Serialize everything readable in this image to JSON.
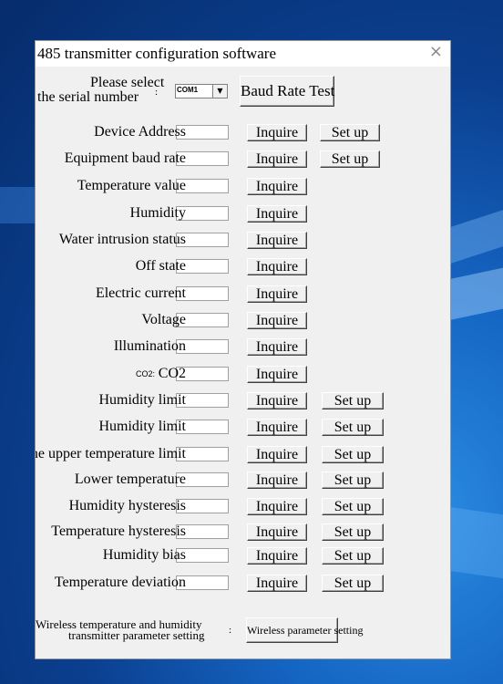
{
  "window": {
    "title": "485 transmitter configuration software",
    "close_glyph": "×"
  },
  "serial": {
    "label_line1": "Please select",
    "label_line2": "the serial number",
    "colon": ":",
    "selected_port": "COM1",
    "dropdown_glyph": "▼",
    "baud_test_label": "Baud Rate Test"
  },
  "rows": [
    {
      "label": "Device Address",
      "inquire": "Inquire",
      "setup": "Set up"
    },
    {
      "label": "Equipment baud rate",
      "inquire": "Inquire",
      "setup": "Set up"
    },
    {
      "label": "Temperature value",
      "inquire": "Inquire"
    },
    {
      "label": "Humidity",
      "inquire": "Inquire"
    },
    {
      "label": "Water intrusion status",
      "inquire": "Inquire"
    },
    {
      "label": "Off state",
      "inquire": "Inquire"
    },
    {
      "label": "Electric current",
      "inquire": "Inquire"
    },
    {
      "label": "Voltage",
      "inquire": "Inquire"
    },
    {
      "label": "Illumination",
      "inquire": "Inquire"
    },
    {
      "label": "CO2",
      "small_label": "CO2:",
      "inquire": "Inquire"
    },
    {
      "label": "Humidity limit",
      "inquire": "Inquire",
      "setup": "Set up"
    },
    {
      "label": "Humidity limit",
      "inquire": "Inquire",
      "setup": "Set up"
    },
    {
      "label": "The upper temperature limit",
      "inquire": "Inquire",
      "setup": "Set up"
    },
    {
      "label": "Lower temperature",
      "inquire": "Inquire",
      "setup": "Set up"
    },
    {
      "label": "Humidity hysteresis",
      "inquire": "Inquire",
      "setup": "Set up"
    },
    {
      "label": "Temperature hysteresis",
      "inquire": "Inquire",
      "setup": "Set up"
    },
    {
      "label": "Humidity bias",
      "inquire": "Inquire",
      "setup": "Set up"
    },
    {
      "label": "Temperature deviation",
      "inquire": "Inquire",
      "setup": "Set up"
    }
  ],
  "wireless": {
    "label_line1": "Wireless temperature and humidity",
    "label_line2": "transmitter parameter setting",
    "colon": ":",
    "button_label": "Wireless parameter setting"
  },
  "colors": {
    "window_bg": "#f0f0f0",
    "desktop_blue": "#0b3f8f"
  }
}
